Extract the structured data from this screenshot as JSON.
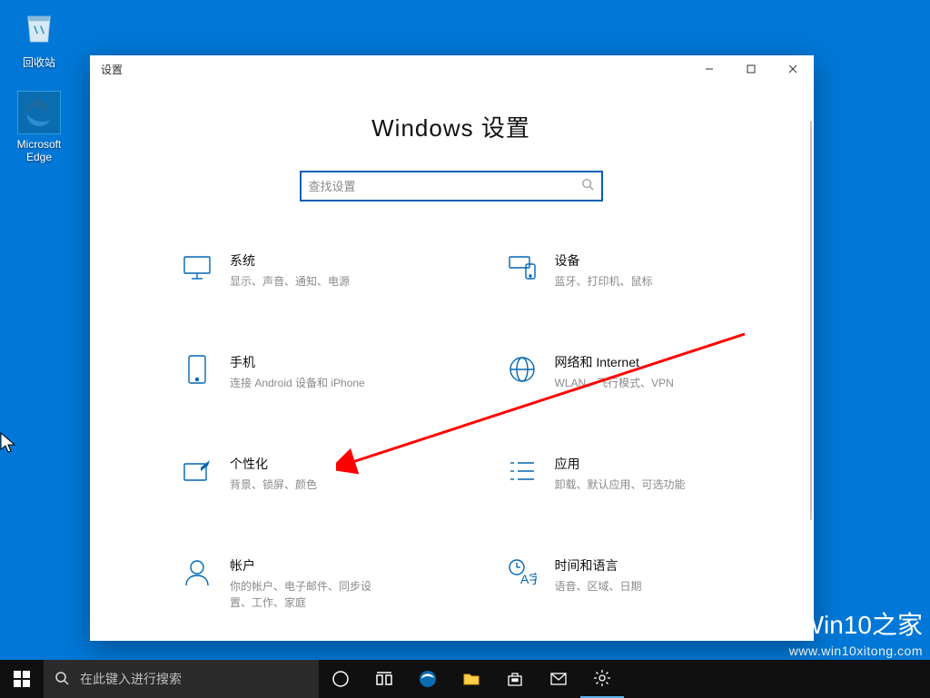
{
  "desktop": {
    "recycle_label": "回收站",
    "edge_label": "Microsoft Edge"
  },
  "window": {
    "title": "设置",
    "page_title": "Windows 设置",
    "search_placeholder": "查找设置"
  },
  "categories": [
    {
      "id": "system",
      "title": "系统",
      "desc": "显示、声音、通知、电源"
    },
    {
      "id": "devices",
      "title": "设备",
      "desc": "蓝牙、打印机、鼠标"
    },
    {
      "id": "phone",
      "title": "手机",
      "desc": "连接 Android 设备和 iPhone"
    },
    {
      "id": "network",
      "title": "网络和 Internet",
      "desc": "WLAN、飞行模式、VPN"
    },
    {
      "id": "personalization",
      "title": "个性化",
      "desc": "背景、锁屏、颜色"
    },
    {
      "id": "apps",
      "title": "应用",
      "desc": "卸载、默认应用、可选功能"
    },
    {
      "id": "accounts",
      "title": "帐户",
      "desc": "你的帐户、电子邮件、同步设置、工作、家庭"
    },
    {
      "id": "time",
      "title": "时间和语言",
      "desc": "语音、区域、日期"
    }
  ],
  "taskbar": {
    "search_placeholder": "在此键入进行搜索"
  },
  "watermark": {
    "brand_prefix": "Win",
    "brand_suffix": "10",
    "brand_tag": "之家",
    "url": "www.win10xitong.com"
  }
}
